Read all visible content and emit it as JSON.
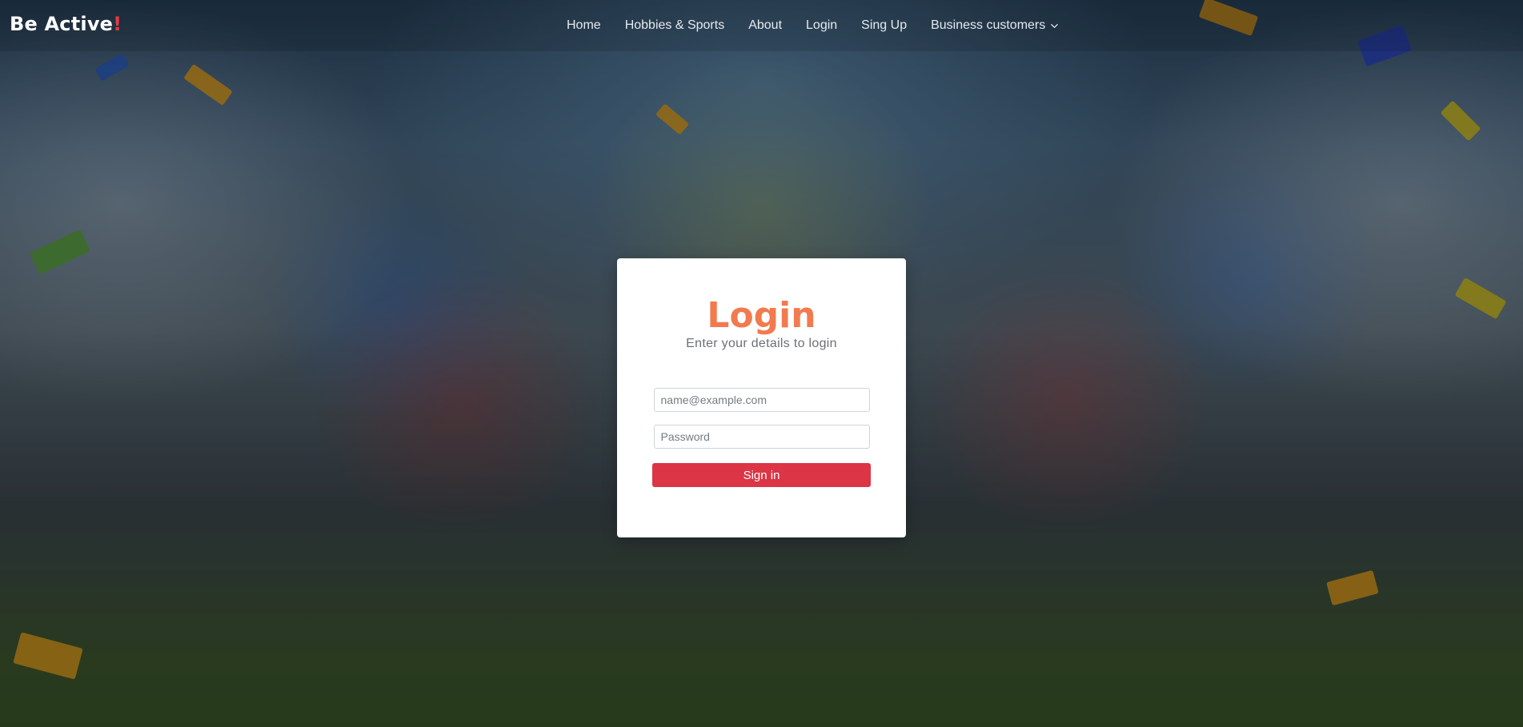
{
  "brand": {
    "name": "Be Active",
    "mark": "!"
  },
  "nav": {
    "items": [
      {
        "label": "Home"
      },
      {
        "label": "Hobbies & Sports"
      },
      {
        "label": "About"
      },
      {
        "label": "Login"
      },
      {
        "label": "Sing Up"
      },
      {
        "label": "Business customers"
      }
    ],
    "dropdown_icon": "chevron-down-icon"
  },
  "login": {
    "title": "Login",
    "subtitle": "Enter your details to login",
    "email_placeholder": "name@example.com",
    "password_placeholder": "Password",
    "submit_label": "Sign in"
  },
  "colors": {
    "title": "#f27a4f",
    "button": "#dc3545",
    "brand_mark": "#e53945"
  }
}
